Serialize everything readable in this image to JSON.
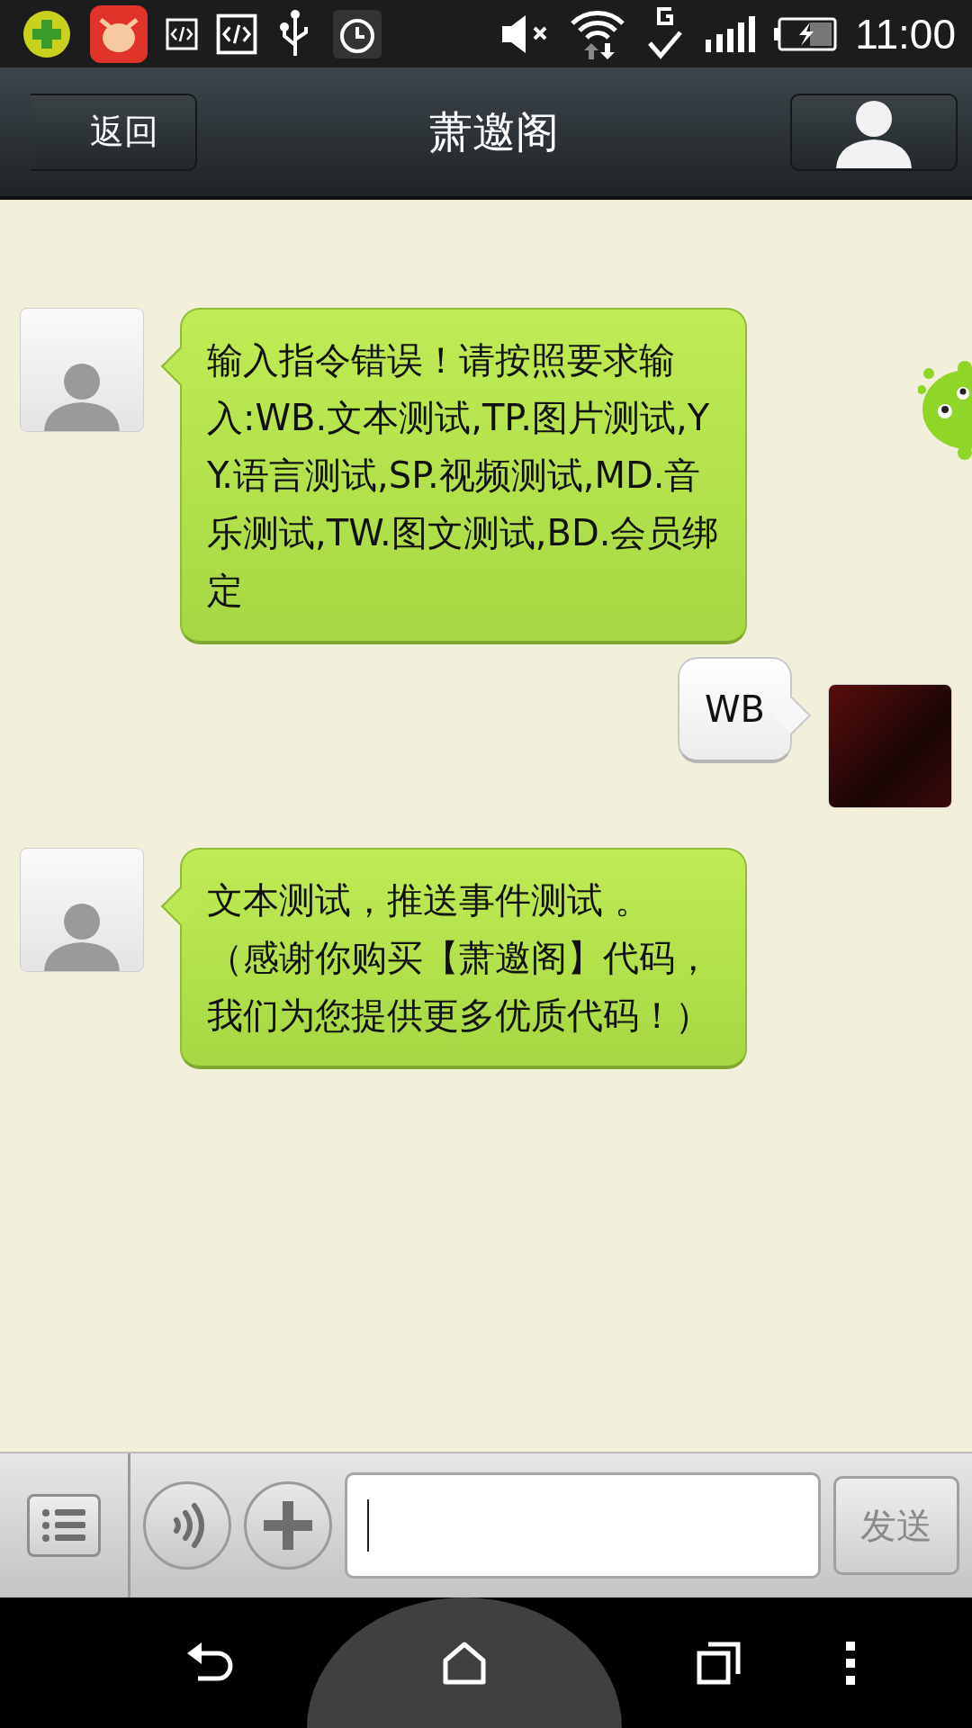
{
  "status_bar": {
    "time": "11:00"
  },
  "header": {
    "back_label": "返回",
    "title": "萧邀阁"
  },
  "messages": [
    {
      "kind": "incoming",
      "text": "输入指令错误！请按照要求输入:WB.文本测试,TP.图片测试,YY.语言测试,SP.视频测试,MD.音乐测试,TW.图文测试,BD.会员绑定"
    },
    {
      "kind": "outgoing",
      "text": "WB"
    },
    {
      "kind": "incoming",
      "text": "文本测试，推送事件测试 。（感谢你购买【萧邀阁】代码，我们为您提供更多优质代码！）"
    }
  ],
  "input_bar": {
    "send_label": "发送"
  }
}
